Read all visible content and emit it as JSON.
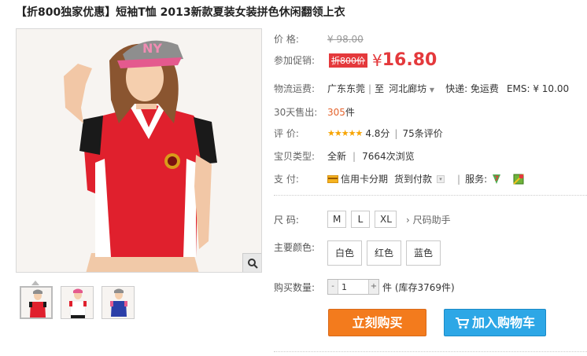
{
  "title": {
    "promo": "【折800独家优惠】",
    "name": "短袖T恤 2013新款夏装女装拼色休闲翻领上衣"
  },
  "price": {
    "label": "价    格:",
    "original": "¥ 98.00"
  },
  "promotion": {
    "label": "参加促销:",
    "badge": "折800价",
    "currency": "¥",
    "value": "16.80"
  },
  "shipping": {
    "label": "物流运费:",
    "from": "广东东莞",
    "sep": "|",
    "to_prefix": "至",
    "to": "河北廊坊",
    "express": "快递: 免运费",
    "ems": "EMS: ¥ 10.00"
  },
  "sales": {
    "label": "30天售出:",
    "count": "305",
    "unit": "件"
  },
  "rating": {
    "label": "评    价:",
    "stars": "★★★★★",
    "score": "4.8分",
    "sep": "|",
    "reviews": "75条评价",
    "value": 4.8
  },
  "item_type": {
    "label": "宝贝类型:",
    "condition": "全新",
    "sep": "|",
    "views": "7664次浏览"
  },
  "payment": {
    "label": "支    付:",
    "credit": "信用卡分期",
    "cod": "货到付款",
    "service_label": "服务:"
  },
  "size": {
    "label": "尺    码:",
    "options": [
      "M",
      "L",
      "XL"
    ],
    "helper": "尺码助手"
  },
  "color": {
    "label": "主要颜色:",
    "options": [
      "白色",
      "红色",
      "蓝色"
    ]
  },
  "quantity": {
    "label": "购买数量:",
    "minus": "-",
    "value": "1",
    "plus": "+",
    "stock": "件 (库存3769件)"
  },
  "actions": {
    "buy": "立刻购买",
    "cart": "加入购物车"
  },
  "colors": {
    "price_red": "#e4393c",
    "buy_orange": "#f37b1d",
    "cart_blue": "#2da7e6"
  }
}
